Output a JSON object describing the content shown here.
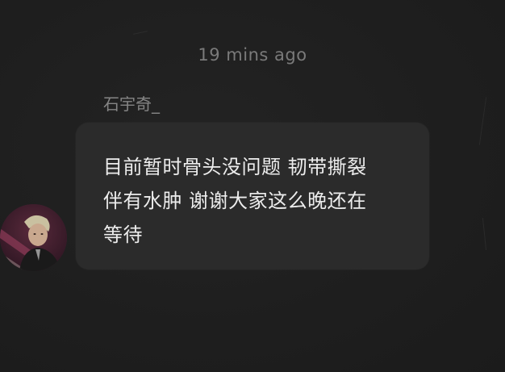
{
  "timestamp": "19  mins ago",
  "message": {
    "sender": "石宇奇_",
    "text": "目前暂时骨头没问题 韧带撕裂\n伴有水肿 谢谢大家这么晚还在\n等待"
  },
  "avatar": {
    "icon": "user-avatar",
    "colors": {
      "background": "#3a2030",
      "accent": "#6a1f3a",
      "highlight": "#c9a88e"
    }
  },
  "colors": {
    "background": "#202020",
    "bubble": "#2b2b2b",
    "message_text": "#ededed",
    "muted_text": "#7a7a7a"
  }
}
